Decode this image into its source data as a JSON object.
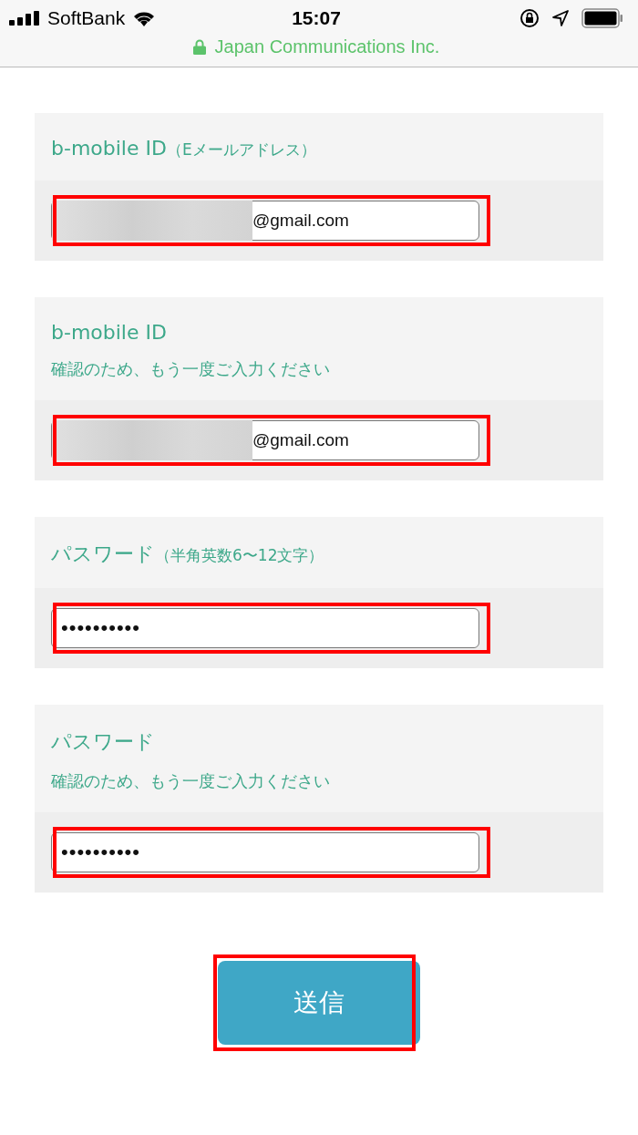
{
  "status_bar": {
    "carrier": "SoftBank",
    "time": "15:07",
    "site": "Japan Communications Inc."
  },
  "fields": [
    {
      "kind": "email",
      "label": "b-mobile ID",
      "note": "（Eメールアドレス）",
      "value": "@gmail.com",
      "redacted": true,
      "highlighted": true
    },
    {
      "kind": "email",
      "label": "b-mobile ID",
      "hint": "確認のため、もう一度ご入力ください",
      "value": "@gmail.com",
      "redacted": true,
      "highlighted": true
    },
    {
      "kind": "password",
      "label": "パスワード",
      "note": "（半角英数6〜12文字）",
      "value": "••••••••••",
      "redacted": false,
      "highlighted": true
    },
    {
      "kind": "password",
      "label": "パスワード",
      "hint": "確認のため、もう一度ご入力ください",
      "value": "••••••••••",
      "redacted": false,
      "highlighted": true
    }
  ],
  "submit": {
    "label": "送信",
    "highlighted": true
  }
}
